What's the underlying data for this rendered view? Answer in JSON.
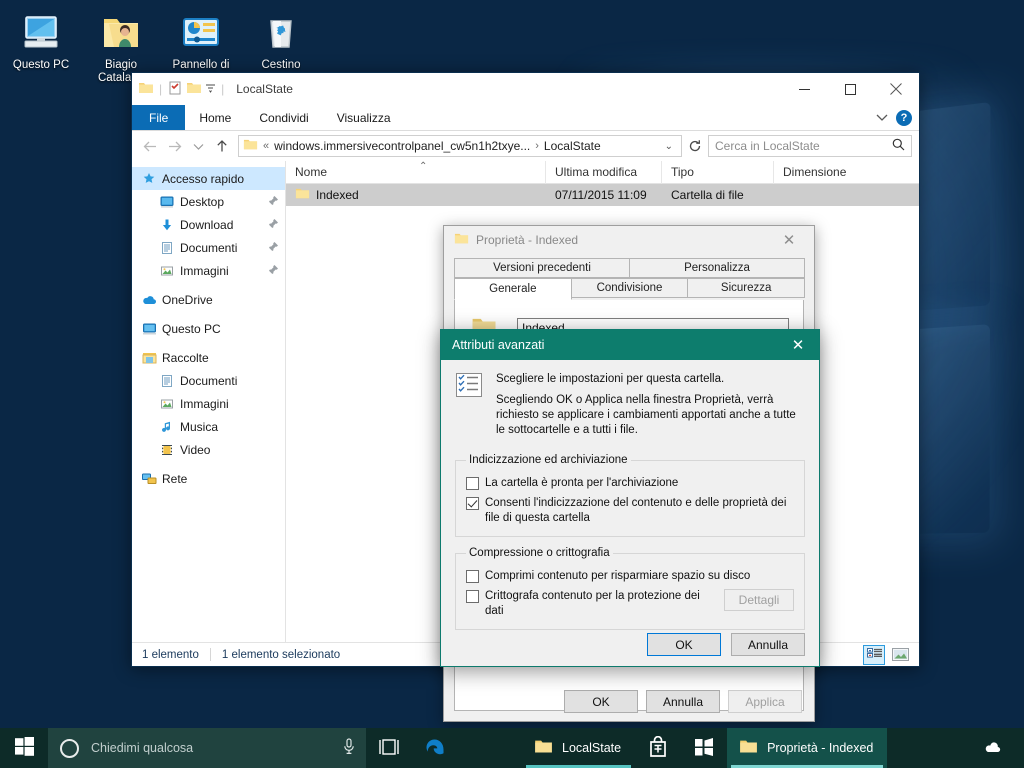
{
  "desktop": {
    "icons": [
      {
        "name": "Questo PC",
        "icon": "computer-icon"
      },
      {
        "name": "Biagio Catalano",
        "icon": "user-folder-icon"
      },
      {
        "name": "Pannello di controllo",
        "icon": "control-panel-icon"
      },
      {
        "name": "Cestino",
        "icon": "recycle-bin-icon"
      }
    ]
  },
  "taskbar": {
    "start_label": "Start",
    "search_placeholder": "Chiedimi qualcosa",
    "mic_icon": "microphone-icon",
    "task_view_icon": "task-view-icon",
    "items": [
      {
        "label": "",
        "icon": "edge-icon",
        "active": false,
        "running": false
      },
      {
        "label": "LocalState",
        "icon": "folder-icon",
        "active": false,
        "running": true
      },
      {
        "label": "",
        "icon": "store-icon",
        "active": false,
        "running": false
      },
      {
        "label": "",
        "icon": "windows-tile-icon",
        "active": false,
        "running": false
      },
      {
        "label": "Proprietà - Indexed",
        "icon": "folder-icon",
        "active": true,
        "running": true
      }
    ],
    "tray": [
      {
        "icon": "onedrive-icon"
      }
    ]
  },
  "explorer": {
    "title": "LocalState",
    "quick_access_icons": [
      "folder-icon",
      "properties-icon",
      "new-folder-icon",
      "customize-chevron-icon"
    ],
    "window_buttons": {
      "minimize": "—",
      "maximize": "▢",
      "close": "✕"
    },
    "ribbon": {
      "tabs": [
        "File",
        "Home",
        "Condividi",
        "Visualizza"
      ],
      "collapse_icon": "chevron-down-icon",
      "help_label": "?"
    },
    "address": {
      "back_icon": "arrow-left-icon",
      "forward_icon": "arrow-right-icon",
      "recent_icon": "chevron-down-icon",
      "up_icon": "arrow-up-icon",
      "overflow": "«",
      "crumbs": [
        "windows.immersivecontrolpanel_cw5n1h2txye...",
        "LocalState"
      ],
      "dropdown_icon": "chevron-down-icon",
      "refresh_icon": "refresh-icon",
      "search_placeholder": "Cerca in LocalState",
      "search_icon": "search-icon"
    },
    "nav_pane": [
      {
        "label": "Accesso rapido",
        "icon": "pin-star-icon",
        "level": 0,
        "selected": true,
        "pinned": false
      },
      {
        "label": "Desktop",
        "icon": "desktop-icon",
        "level": 1,
        "selected": false,
        "pinned": true
      },
      {
        "label": "Download",
        "icon": "download-icon",
        "level": 1,
        "selected": false,
        "pinned": true
      },
      {
        "label": "Documenti",
        "icon": "document-icon",
        "level": 1,
        "selected": false,
        "pinned": true
      },
      {
        "label": "Immagini",
        "icon": "picture-icon",
        "level": 1,
        "selected": false,
        "pinned": true
      },
      {
        "label": "OneDrive",
        "icon": "onedrive-icon",
        "level": 0,
        "selected": false,
        "pinned": false
      },
      {
        "label": "Questo PC",
        "icon": "computer-icon",
        "level": 0,
        "selected": false,
        "pinned": false
      },
      {
        "label": "Raccolte",
        "icon": "libraries-icon",
        "level": 0,
        "selected": false,
        "pinned": false
      },
      {
        "label": "Documenti",
        "icon": "document-icon",
        "level": 1,
        "selected": false,
        "pinned": false
      },
      {
        "label": "Immagini",
        "icon": "picture-icon",
        "level": 1,
        "selected": false,
        "pinned": false
      },
      {
        "label": "Musica",
        "icon": "music-icon",
        "level": 1,
        "selected": false,
        "pinned": false
      },
      {
        "label": "Video",
        "icon": "video-icon",
        "level": 1,
        "selected": false,
        "pinned": false
      },
      {
        "label": "Rete",
        "icon": "network-icon",
        "level": 0,
        "selected": false,
        "pinned": false
      }
    ],
    "columns": [
      "Nome",
      "Ultima modifica",
      "Tipo",
      "Dimensione"
    ],
    "sort_column": "Nome",
    "sort_caret": "⌃",
    "rows": [
      {
        "name": "Indexed",
        "modified": "07/11/2015 11:09",
        "type": "Cartella di file",
        "size": "",
        "icon": "folder-icon",
        "selected": true
      }
    ],
    "status": {
      "count": "1 elemento",
      "selection": "1 elemento selezionato"
    },
    "view_buttons": [
      {
        "icon": "details-view-icon",
        "active": true
      },
      {
        "icon": "large-icons-view-icon",
        "active": false
      }
    ]
  },
  "properties_dialog": {
    "title": "Proprietà - Indexed",
    "icon": "folder-icon",
    "close_icon": "close-icon",
    "tabs_row1": [
      "Versioni precedenti",
      "Personalizza"
    ],
    "tabs_row2": [
      "Generale",
      "Condivisione",
      "Sicurezza"
    ],
    "active_tab": "Generale",
    "name_value": "Indexed",
    "buttons": [
      {
        "label": "OK",
        "enabled": true
      },
      {
        "label": "Annulla",
        "enabled": true
      },
      {
        "label": "Applica",
        "enabled": false
      }
    ]
  },
  "advanced_dialog": {
    "title": "Attributi avanzati",
    "title_bg": "#0d7d6d",
    "close_icon": "close-icon",
    "info_icon": "attributes-checklist-icon",
    "intro_line1": "Scegliere le impostazioni per questa cartella.",
    "intro_line2": "Scegliendo OK o Applica nella finestra Proprietà, verrà richiesto se applicare i cambiamenti apportati anche a tutte le sottocartelle e a tutti i file.",
    "group_archiving": {
      "legend": "Indicizzazione ed archiviazione",
      "options": [
        {
          "label": "La cartella è pronta per l'archiviazione",
          "checked": false
        },
        {
          "label": "Consenti l'indicizzazione del contenuto e delle proprietà dei file di questa cartella",
          "checked": true
        }
      ]
    },
    "group_compression": {
      "legend": "Compressione o crittografia",
      "options": [
        {
          "label": "Comprimi contenuto per risparmiare spazio su disco",
          "checked": false,
          "button": null
        },
        {
          "label": "Crittografa contenuto per la protezione dei dati",
          "checked": false,
          "button": "Dettagli"
        }
      ],
      "details_label": "Dettagli",
      "details_enabled": false
    },
    "buttons": [
      {
        "label": "OK",
        "default": true
      },
      {
        "label": "Annulla",
        "default": false
      }
    ]
  }
}
